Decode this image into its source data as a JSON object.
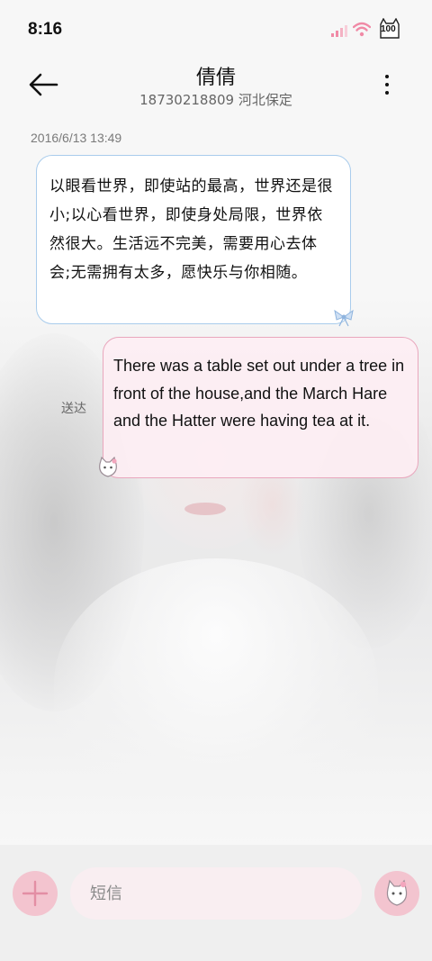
{
  "status_bar": {
    "time": "8:16",
    "battery_level": "100",
    "icons": [
      "signal-icon",
      "wifi-icon",
      "battery-cat-icon"
    ]
  },
  "header": {
    "contact_name": "倩倩",
    "contact_detail": "18730218809 河北保定",
    "back_icon": "arrow-left-icon",
    "menu_icon": "more-vertical-icon"
  },
  "conversation": {
    "timestamp": "2016/6/13 13:49",
    "messages": [
      {
        "direction": "incoming",
        "text": "以眼看世界，即使站的最高，世界还是很小;以心看世界，即使身处局限，世界依然很大。生活远不完美，需要用心去体会;无需拥有太多，愿快乐与你相随。"
      },
      {
        "direction": "outgoing",
        "text": "There was a table set out under a tree in front of the house,and the March Hare and the Hatter were having tea at it.",
        "status": "送达"
      }
    ]
  },
  "composer": {
    "placeholder": "短信",
    "value": "",
    "attach_icon": "plus-icon",
    "send_icon": "cat-send-icon"
  },
  "colors": {
    "incoming_border": "#a9ccec",
    "outgoing_border": "#e9a7bd",
    "outgoing_fill": "#fdeef3",
    "accent_pink": "#f3c4cf",
    "signal_pink": "#f08aa6"
  }
}
